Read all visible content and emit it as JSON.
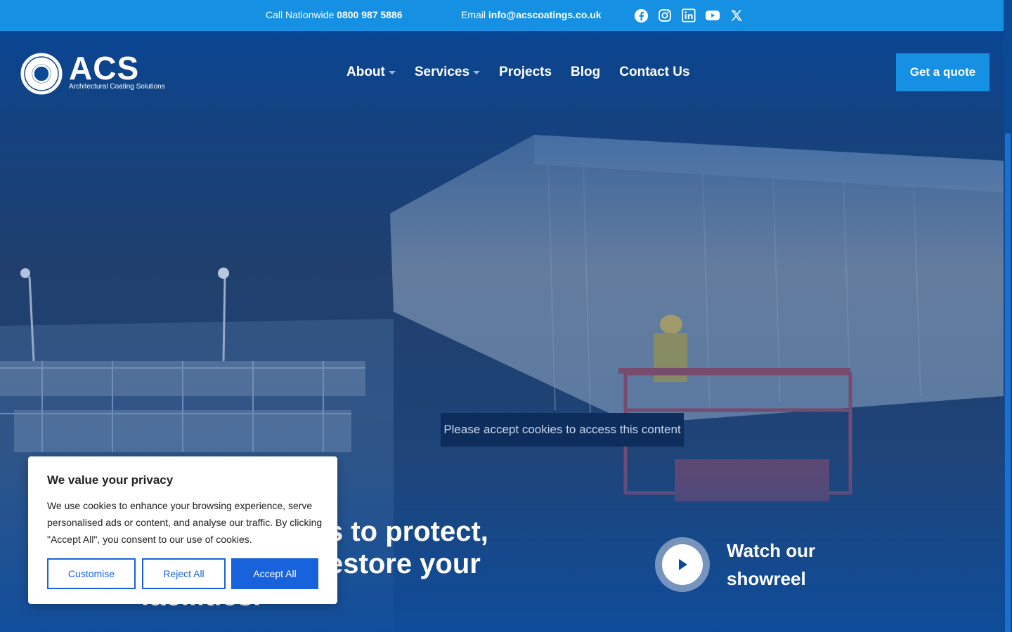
{
  "topbar": {
    "call_prefix": "Call Nationwide",
    "phone": "0800 987 5886",
    "email_prefix": "Email",
    "email": "info@acscoatings.co.uk",
    "socials": [
      "facebook-icon",
      "instagram-icon",
      "linkedin-icon",
      "youtube-icon",
      "x-icon"
    ]
  },
  "logo": {
    "name": "ACS",
    "tagline": "Architectural Coating Solutions"
  },
  "nav": {
    "items": [
      {
        "label": "About",
        "dropdown": true
      },
      {
        "label": "Services",
        "dropdown": true
      },
      {
        "label": "Projects",
        "dropdown": false
      },
      {
        "label": "Blog",
        "dropdown": false
      },
      {
        "label": "Contact Us",
        "dropdown": false
      }
    ],
    "cta": "Get a quote"
  },
  "hero": {
    "cookie_notice": "Please accept cookies to access this content",
    "headline_visible": "s to protect, estore your facilities.",
    "headline_line1": "s to protect,",
    "headline_line2": "estore your",
    "headline_line3": "facilities.",
    "showreel_label": "Watch our showreel"
  },
  "consent": {
    "title": "We value your privacy",
    "body": "We use cookies to enhance your browsing experience, serve personalised ads or content, and analyse our traffic. By clicking \"Accept All\", you consent to our use of cookies.",
    "customise": "Customise",
    "reject": "Reject All",
    "accept": "Accept All"
  },
  "colors": {
    "topbar": "#1590e3",
    "background": "#0a4a96",
    "cta": "#1590e3",
    "consent_button": "#1863dc"
  }
}
